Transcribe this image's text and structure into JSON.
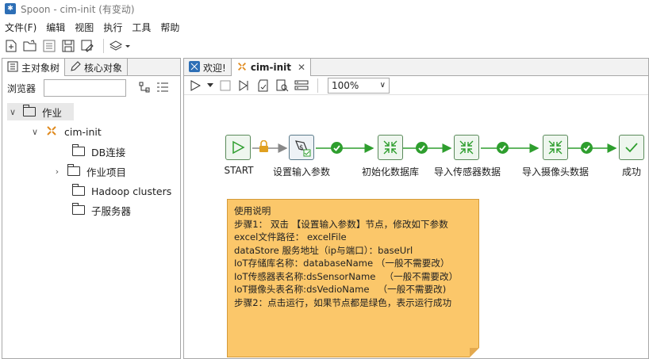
{
  "window": {
    "title": "Spoon - cim-init (有变动)"
  },
  "menu": [
    "文件(F)",
    "编辑",
    "视图",
    "执行",
    "工具",
    "帮助"
  ],
  "left_panel": {
    "tabs": [
      "主对象树",
      "核心对象"
    ],
    "browser_label": "浏览器",
    "search_value": "",
    "tree": {
      "root": "作业",
      "job": "cim-init",
      "children": [
        "DB连接",
        "作业项目",
        "Hadoop clusters",
        "子服务器"
      ]
    }
  },
  "right_panel": {
    "tabs": [
      "欢迎!",
      "cim-init"
    ],
    "zoom": "100%",
    "nodes": [
      "START",
      "设置输入参数",
      "初始化数据库",
      "导入传感器数据",
      "导入摄像头数据",
      "成功"
    ],
    "note": [
      "使用说明",
      "",
      "步骤1： 双击 【设置输入参数】节点，修改如下参数",
      "",
      "excel文件路径： excelFile",
      "dataStore 服务地址（ip与端口）：baseUrl",
      "IoT存储库名称：databaseName （一般不需要改）",
      "IoT传感器表名称:dsSensorName   （一般不需要改）",
      "IoT摄像头表名称:dsVedioName   （一般不需要改)",
      "",
      "步骤2：点击运行，如果节点都是绿色，表示运行成功"
    ]
  },
  "colors": {
    "node_border": "#5a8a5a",
    "ok": "#2e9e2e",
    "hop": "#2e9e2e",
    "note_bg": "#fbc76a",
    "lock": "#e0a020"
  }
}
